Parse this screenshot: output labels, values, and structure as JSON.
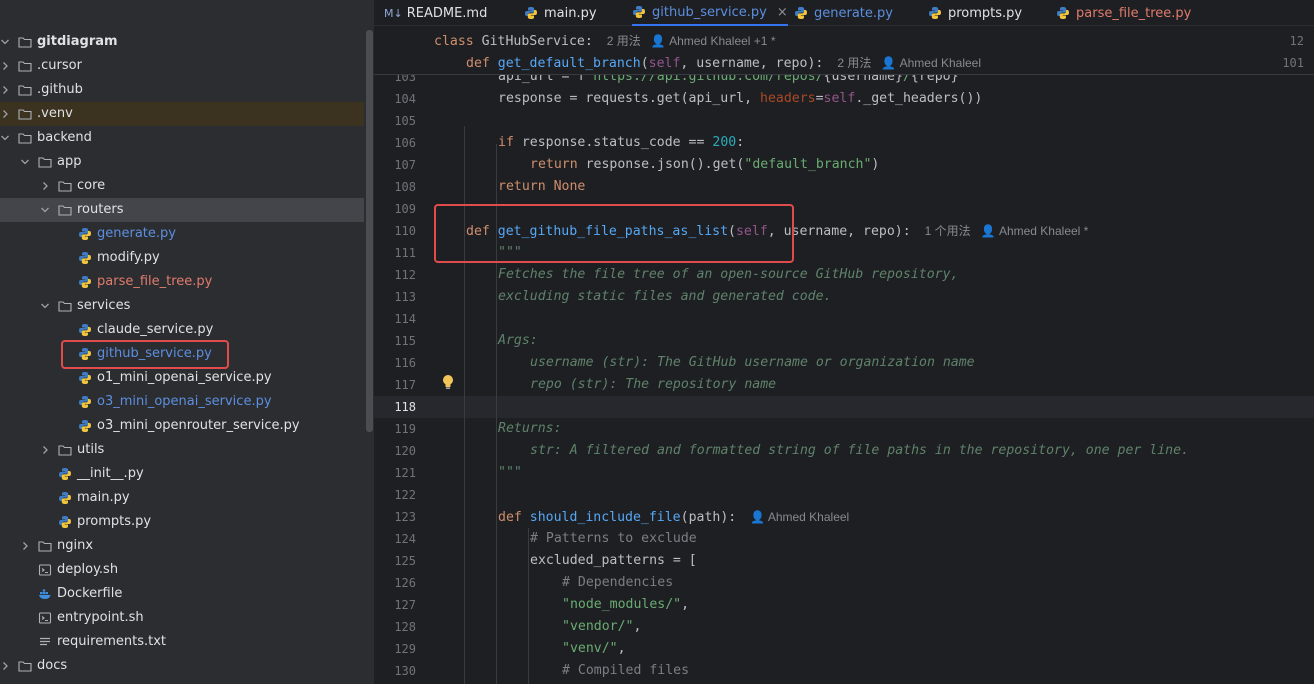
{
  "tabs": [
    {
      "label": "README.md",
      "icon": "markdown-icon",
      "active": false,
      "color": "default",
      "prefix": "M↓"
    },
    {
      "label": "main.py",
      "icon": "python-icon",
      "active": false,
      "color": "default"
    },
    {
      "label": "github_service.py",
      "icon": "python-icon",
      "active": true,
      "color": "blue",
      "close": "×"
    },
    {
      "label": "generate.py",
      "icon": "python-icon",
      "active": false,
      "color": "blue"
    },
    {
      "label": "prompts.py",
      "icon": "python-icon",
      "active": false,
      "color": "default"
    },
    {
      "label": "parse_file_tree.py",
      "icon": "python-icon",
      "active": false,
      "color": "red"
    }
  ],
  "tree": [
    {
      "label": "gitdiagram",
      "type": "folder",
      "expanded": true,
      "depth": 0,
      "bold": true
    },
    {
      "label": ".cursor",
      "type": "folder",
      "expanded": false,
      "depth": 0
    },
    {
      "label": ".github",
      "type": "folder",
      "expanded": false,
      "depth": 0
    },
    {
      "label": ".venv",
      "type": "folder",
      "expanded": false,
      "depth": 0,
      "excluded": true
    },
    {
      "label": "backend",
      "type": "folder",
      "expanded": true,
      "depth": 0
    },
    {
      "label": "app",
      "type": "folder",
      "expanded": true,
      "depth": 1
    },
    {
      "label": "core",
      "type": "folder",
      "expanded": false,
      "depth": 2
    },
    {
      "label": "routers",
      "type": "folder",
      "expanded": true,
      "depth": 2,
      "selected": true
    },
    {
      "label": "generate.py",
      "type": "py",
      "depth": 3,
      "color": "blue"
    },
    {
      "label": "modify.py",
      "type": "py",
      "depth": 3
    },
    {
      "label": "parse_file_tree.py",
      "type": "py",
      "depth": 3,
      "color": "red"
    },
    {
      "label": "services",
      "type": "folder",
      "expanded": true,
      "depth": 2
    },
    {
      "label": "claude_service.py",
      "type": "py",
      "depth": 3
    },
    {
      "label": "github_service.py",
      "type": "py",
      "depth": 3,
      "color": "blue"
    },
    {
      "label": "o1_mini_openai_service.py",
      "type": "py",
      "depth": 3
    },
    {
      "label": "o3_mini_openai_service.py",
      "type": "py",
      "depth": 3,
      "color": "blue"
    },
    {
      "label": "o3_mini_openrouter_service.py",
      "type": "py",
      "depth": 3
    },
    {
      "label": "utils",
      "type": "folder",
      "expanded": false,
      "depth": 2
    },
    {
      "label": "__init__.py",
      "type": "py",
      "depth": 2
    },
    {
      "label": "main.py",
      "type": "py",
      "depth": 2
    },
    {
      "label": "prompts.py",
      "type": "py",
      "depth": 2
    },
    {
      "label": "nginx",
      "type": "folder",
      "expanded": false,
      "depth": 1
    },
    {
      "label": "deploy.sh",
      "type": "sh",
      "depth": 1
    },
    {
      "label": "Dockerfile",
      "type": "docker",
      "depth": 1
    },
    {
      "label": "entrypoint.sh",
      "type": "sh",
      "depth": 1
    },
    {
      "label": "requirements.txt",
      "type": "txt",
      "depth": 1
    },
    {
      "label": "docs",
      "type": "folder",
      "expanded": false,
      "depth": 0
    }
  ],
  "sticky": [
    {
      "num": "12",
      "indent": 0,
      "tokens": [
        [
          "kw",
          "class "
        ],
        [
          "plain",
          "GitHubService:"
        ]
      ],
      "hint": "2 用法   👤 Ahmed Khaleel +1 *"
    },
    {
      "num": "101",
      "indent": 1,
      "tokens": [
        [
          "kw",
          "def "
        ],
        [
          "fn",
          "get_default_branch"
        ],
        [
          "plain",
          "("
        ],
        [
          "self",
          "self"
        ],
        [
          "plain",
          ", username, repo):"
        ]
      ],
      "hint": "2 用法   👤 Ahmed Khaleel"
    }
  ],
  "lines": [
    {
      "num": "103",
      "indent": 2,
      "tokens": [
        [
          "plain",
          "api_url = f"
        ],
        [
          "str",
          "\"https://api.github.com/repos/"
        ],
        [
          "plain",
          "{username}"
        ],
        [
          "str",
          "/"
        ],
        [
          "plain",
          "{repo}"
        ],
        [
          "str",
          "\""
        ]
      ]
    },
    {
      "num": "104",
      "indent": 2,
      "tokens": [
        [
          "plain",
          "response = requests.get(api_url, "
        ],
        [
          "par",
          "headers"
        ],
        [
          "plain",
          "="
        ],
        [
          "self",
          "self"
        ],
        [
          "plain",
          "._get_headers())"
        ]
      ]
    },
    {
      "num": "105",
      "indent": 0,
      "tokens": []
    },
    {
      "num": "106",
      "indent": 2,
      "tokens": [
        [
          "kw",
          "if "
        ],
        [
          "plain",
          "response.status_code == "
        ],
        [
          "num",
          "200"
        ],
        [
          "plain",
          ":"
        ]
      ]
    },
    {
      "num": "107",
      "indent": 3,
      "tokens": [
        [
          "kw",
          "return "
        ],
        [
          "plain",
          "response.json().get("
        ],
        [
          "str",
          "\"default_branch\""
        ],
        [
          "plain",
          ")"
        ]
      ]
    },
    {
      "num": "108",
      "indent": 2,
      "tokens": [
        [
          "kw",
          "return "
        ],
        [
          "kw",
          "None"
        ]
      ]
    },
    {
      "num": "109",
      "indent": 0,
      "tokens": []
    },
    {
      "num": "110",
      "indent": 1,
      "tokens": [
        [
          "kw",
          "def "
        ],
        [
          "fn",
          "get_github_file_paths_as_list"
        ],
        [
          "plain",
          "("
        ],
        [
          "self",
          "self"
        ],
        [
          "plain",
          ", username, repo):"
        ]
      ],
      "hint": "1 个用法   👤 Ahmed Khaleel *"
    },
    {
      "num": "111",
      "indent": 2,
      "tokens": [
        [
          "doc",
          "\"\"\""
        ]
      ]
    },
    {
      "num": "112",
      "indent": 2,
      "tokens": [
        [
          "doc",
          "Fetches the file tree of an open-source GitHub repository,"
        ]
      ]
    },
    {
      "num": "113",
      "indent": 2,
      "tokens": [
        [
          "doc",
          "excluding static files and generated code."
        ]
      ]
    },
    {
      "num": "114",
      "indent": 0,
      "tokens": []
    },
    {
      "num": "115",
      "indent": 2,
      "tokens": [
        [
          "doc",
          "Args:"
        ]
      ]
    },
    {
      "num": "116",
      "indent": 3,
      "tokens": [
        [
          "doc",
          "username (str): The GitHub username or organization name"
        ]
      ]
    },
    {
      "num": "117",
      "indent": 3,
      "tokens": [
        [
          "doc",
          "repo (str): The repository name"
        ]
      ]
    },
    {
      "num": "118",
      "indent": 0,
      "tokens": [],
      "current": true
    },
    {
      "num": "119",
      "indent": 2,
      "tokens": [
        [
          "doc",
          "Returns:"
        ]
      ]
    },
    {
      "num": "120",
      "indent": 3,
      "tokens": [
        [
          "doc",
          "str: A filtered and formatted string of file paths in the repository, one per line."
        ]
      ]
    },
    {
      "num": "121",
      "indent": 2,
      "tokens": [
        [
          "doc",
          "\"\"\""
        ]
      ]
    },
    {
      "num": "122",
      "indent": 0,
      "tokens": []
    },
    {
      "num": "123",
      "indent": 2,
      "tokens": [
        [
          "kw",
          "def "
        ],
        [
          "fn",
          "should_include_file"
        ],
        [
          "plain",
          "(path):"
        ]
      ],
      "hint": "👤 Ahmed Khaleel"
    },
    {
      "num": "124",
      "indent": 3,
      "tokens": [
        [
          "cmt",
          "# Patterns to exclude"
        ]
      ]
    },
    {
      "num": "125",
      "indent": 3,
      "tokens": [
        [
          "plain",
          "excluded_patterns = ["
        ]
      ]
    },
    {
      "num": "126",
      "indent": 4,
      "tokens": [
        [
          "cmt",
          "# Dependencies"
        ]
      ]
    },
    {
      "num": "127",
      "indent": 4,
      "tokens": [
        [
          "str",
          "\"node_modules/\""
        ],
        [
          "plain",
          ","
        ]
      ]
    },
    {
      "num": "128",
      "indent": 4,
      "tokens": [
        [
          "str",
          "\"vendor/\""
        ],
        [
          "plain",
          ","
        ]
      ]
    },
    {
      "num": "129",
      "indent": 4,
      "tokens": [
        [
          "str",
          "\"venv/\""
        ],
        [
          "plain",
          ","
        ]
      ]
    },
    {
      "num": "130",
      "indent": 4,
      "tokens": [
        [
          "cmt",
          "# Compiled files"
        ]
      ]
    }
  ],
  "colors": {
    "accent": "#3574f0",
    "highlight_box": "#e04b4b",
    "modified": "#5c8fe0",
    "error": "#e07b6c"
  }
}
